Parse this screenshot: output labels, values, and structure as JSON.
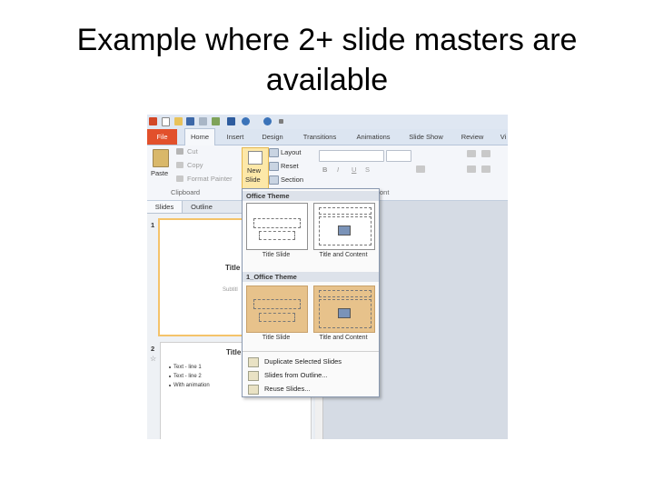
{
  "slide": {
    "title": "Example where 2+ slide  masters are available"
  },
  "ribbon": {
    "tabs": [
      "File",
      "Home",
      "Insert",
      "Design",
      "Transitions",
      "Animations",
      "Slide Show",
      "Review",
      "Vi"
    ],
    "clipboard": {
      "paste": "Paste",
      "cut": "Cut",
      "copy": "Copy",
      "format_painter": "Format Painter",
      "group": "Clipboard"
    },
    "slides": {
      "new_slide_line1": "New",
      "new_slide_line2": "Slide",
      "layout": "Layout",
      "reset": "Reset",
      "section": "Section"
    },
    "font": {
      "bold": "B",
      "italic": "I",
      "underline": "U",
      "strike": "S",
      "group_partial": "ont"
    }
  },
  "pane": {
    "tabs": [
      "Slides",
      "Outline"
    ],
    "thumbnails": [
      {
        "number": "1",
        "title": "Title",
        "subtitle": "Subtitl"
      },
      {
        "number": "2",
        "title": "Title",
        "bullets": [
          "Text - line 1",
          "Text - line 2",
          "With animation"
        ]
      }
    ]
  },
  "new_slide_menu": {
    "sections": [
      {
        "header": "Office Theme",
        "layouts": [
          "Title Slide",
          "Title and Content"
        ]
      },
      {
        "header": "1_Office Theme",
        "layouts": [
          "Title Slide",
          "Title and Content"
        ]
      }
    ],
    "items": [
      "Duplicate Selected Slides",
      "Slides from Outline...",
      "Reuse Slides..."
    ]
  },
  "colors": {
    "file_tab": "#e2502b",
    "selected_thumb": "#f4c36a",
    "theme2_fill": "#e7c28b"
  }
}
